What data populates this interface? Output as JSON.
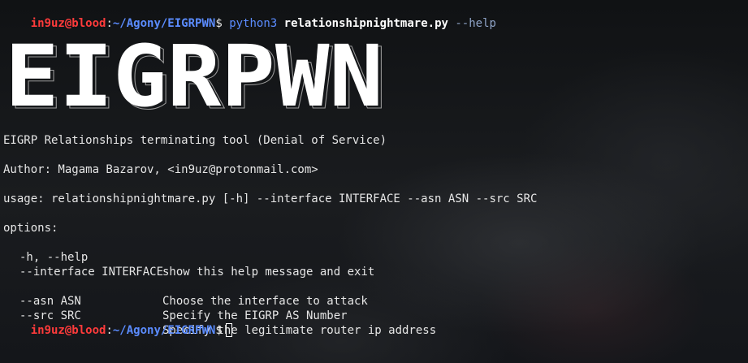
{
  "prompt": {
    "user": "in9uz@blood",
    "path": "~/Agony/EIGRPWN",
    "symbol": "$"
  },
  "command": {
    "program": "python3",
    "script": "relationshipnightmare.py",
    "args": "--help"
  },
  "banner": {
    "text": "EIGRPWN"
  },
  "output": {
    "description": "EIGRP Relationships terminating tool (Denial of Service)",
    "author": "Author: Magama Bazarov, <in9uz@protonmail.com>",
    "usage": "usage: relationshipnightmare.py [-h] --interface INTERFACE --asn ASN --src SRC",
    "options_header": "options:",
    "options": [
      {
        "flag": "-h, --help",
        "desc": "show this help message and exit"
      },
      {
        "flag": "--interface INTERFACE",
        "desc": ""
      },
      {
        "flag": "",
        "desc": "Choose the interface to attack"
      },
      {
        "flag": "--asn ASN",
        "desc": "Specify the EIGRP AS Number"
      },
      {
        "flag": "--src SRC",
        "desc": "Specify the legitimate router ip address"
      }
    ]
  },
  "colors": {
    "user": "#ff3b3b",
    "path": "#5b8cff",
    "text": "#e6e6e6",
    "background": "#15171a"
  }
}
